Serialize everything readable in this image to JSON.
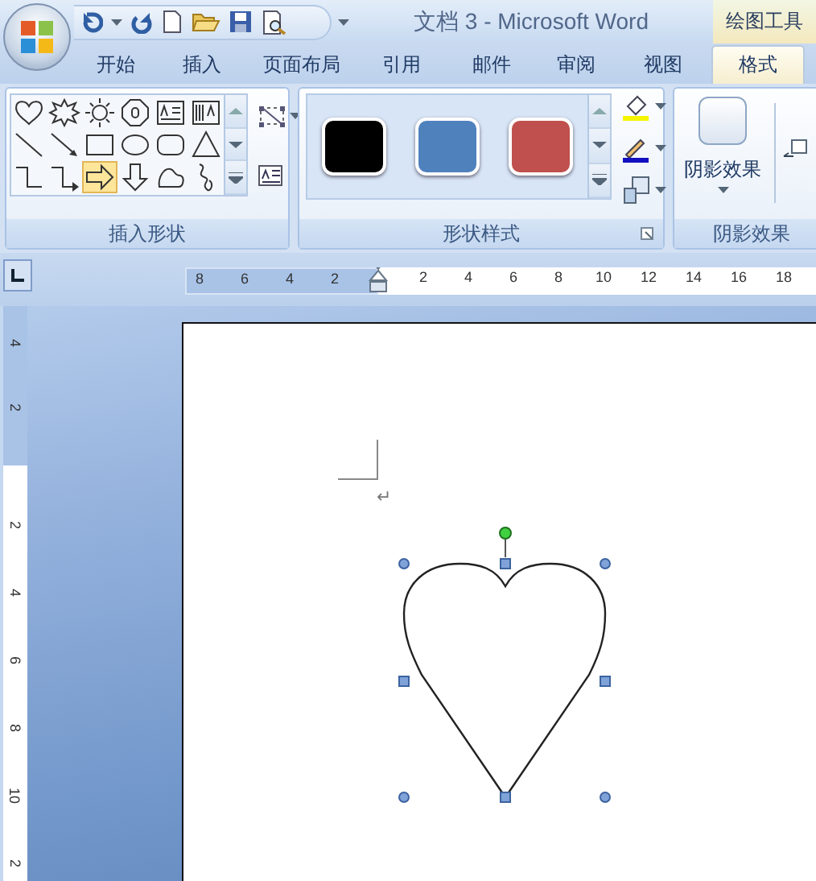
{
  "title_bar": {
    "title": "文档 3 - Microsoft Word",
    "context_tab_title": "绘图工具"
  },
  "tabs": [
    {
      "label": "开始",
      "selected": false
    },
    {
      "label": "插入",
      "selected": false
    },
    {
      "label": "页面布局",
      "selected": false
    },
    {
      "label": "引用",
      "selected": false
    },
    {
      "label": "邮件",
      "selected": false
    },
    {
      "label": "审阅",
      "selected": false
    },
    {
      "label": "视图",
      "selected": false
    },
    {
      "label": "格式",
      "selected": true
    }
  ],
  "ribbon": {
    "insert_shapes": {
      "label": "插入形状",
      "shapes": [
        {
          "kind": "heart",
          "selected": false
        },
        {
          "kind": "explosion",
          "selected": false
        },
        {
          "kind": "sun",
          "selected": false
        },
        {
          "kind": "octagon",
          "selected": false
        },
        {
          "kind": "textbox",
          "selected": false
        },
        {
          "kind": "vtextbox",
          "selected": false
        },
        {
          "kind": "line",
          "selected": false
        },
        {
          "kind": "arrowline",
          "selected": false
        },
        {
          "kind": "rect",
          "selected": false
        },
        {
          "kind": "oval",
          "selected": false
        },
        {
          "kind": "roundrect",
          "selected": false
        },
        {
          "kind": "triangle",
          "selected": false
        },
        {
          "kind": "elbow",
          "selected": false
        },
        {
          "kind": "elbowarrow",
          "selected": false
        },
        {
          "kind": "rightarrow",
          "selected": true
        },
        {
          "kind": "downarrow",
          "selected": false
        },
        {
          "kind": "blob",
          "selected": false
        },
        {
          "kind": "scribble",
          "selected": false
        }
      ]
    },
    "shape_styles": {
      "label": "形状样式",
      "styles": [
        {
          "color": "#000000"
        },
        {
          "color": "#4f81bd"
        },
        {
          "color": "#c0504d"
        }
      ]
    },
    "shadow_effects": {
      "label": "阴影效果",
      "button_label": "阴影效果"
    }
  },
  "horizontal_ruler": {
    "left_numbers": [
      "8",
      "6",
      "4",
      "2"
    ],
    "right_numbers": [
      "2",
      "4",
      "6",
      "8",
      "10",
      "12",
      "14",
      "16",
      "18"
    ]
  },
  "vertical_ruler": {
    "top_numbers": [
      "4",
      "2"
    ],
    "bottom_numbers": [
      "2",
      "4",
      "6",
      "8",
      "10",
      "2"
    ]
  },
  "document": {
    "paragraph_mark": "↵",
    "shape": {
      "kind": "heart",
      "selected": true
    }
  }
}
